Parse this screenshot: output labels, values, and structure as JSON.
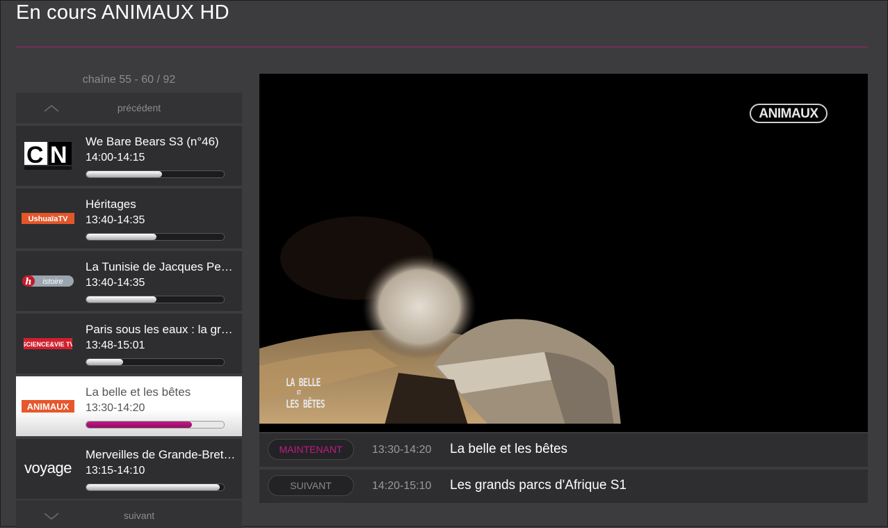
{
  "header": {
    "title": "En cours ANIMAUX HD"
  },
  "channel_list": {
    "counter": "chaîne 55 - 60 / 92",
    "prev_label": "précédent",
    "next_label": "suivant",
    "items": [
      {
        "logo": "CN",
        "title": "We Bare Bears S3 (n°46)",
        "time": "14:00-14:15",
        "progress": 0.55,
        "active": false
      },
      {
        "logo": "UshuaïaTV",
        "title": "Héritages",
        "time": "13:40-14:35",
        "progress": 0.51,
        "active": false
      },
      {
        "logo": "histoire",
        "title": "La Tunisie de Jacques Pe…",
        "time": "13:40-14:35",
        "progress": 0.51,
        "active": false
      },
      {
        "logo": "SCIENCE & VIE TV",
        "title": "Paris sous les eaux : la gr…",
        "time": "13:48-15:01",
        "progress": 0.27,
        "active": false
      },
      {
        "logo": "ANIMAUX",
        "title": "La belle et les bêtes",
        "time": "13:30-14:20",
        "progress": 0.77,
        "active": true
      },
      {
        "logo": "voyage",
        "title": "Merveilles de Grande-Bret…",
        "time": "13:15-14:10",
        "progress": 0.97,
        "active": false
      }
    ]
  },
  "player": {
    "channel_badge": "ANIMAUX",
    "caption_line1": "LA BELLE",
    "caption_et": "ET",
    "caption_line2": "LES BÊTES"
  },
  "schedule": {
    "now": {
      "label": "MAINTENANT",
      "time": "13:30-14:20",
      "title": "La belle et les bêtes"
    },
    "next": {
      "label": "SUIVANT",
      "time": "14:20-15:10",
      "title": "Les grands parcs d'Afrique S1"
    }
  },
  "colors": {
    "accent": "#a8226d",
    "now_label": "#c01a86",
    "next_label": "#8a8a8a"
  }
}
